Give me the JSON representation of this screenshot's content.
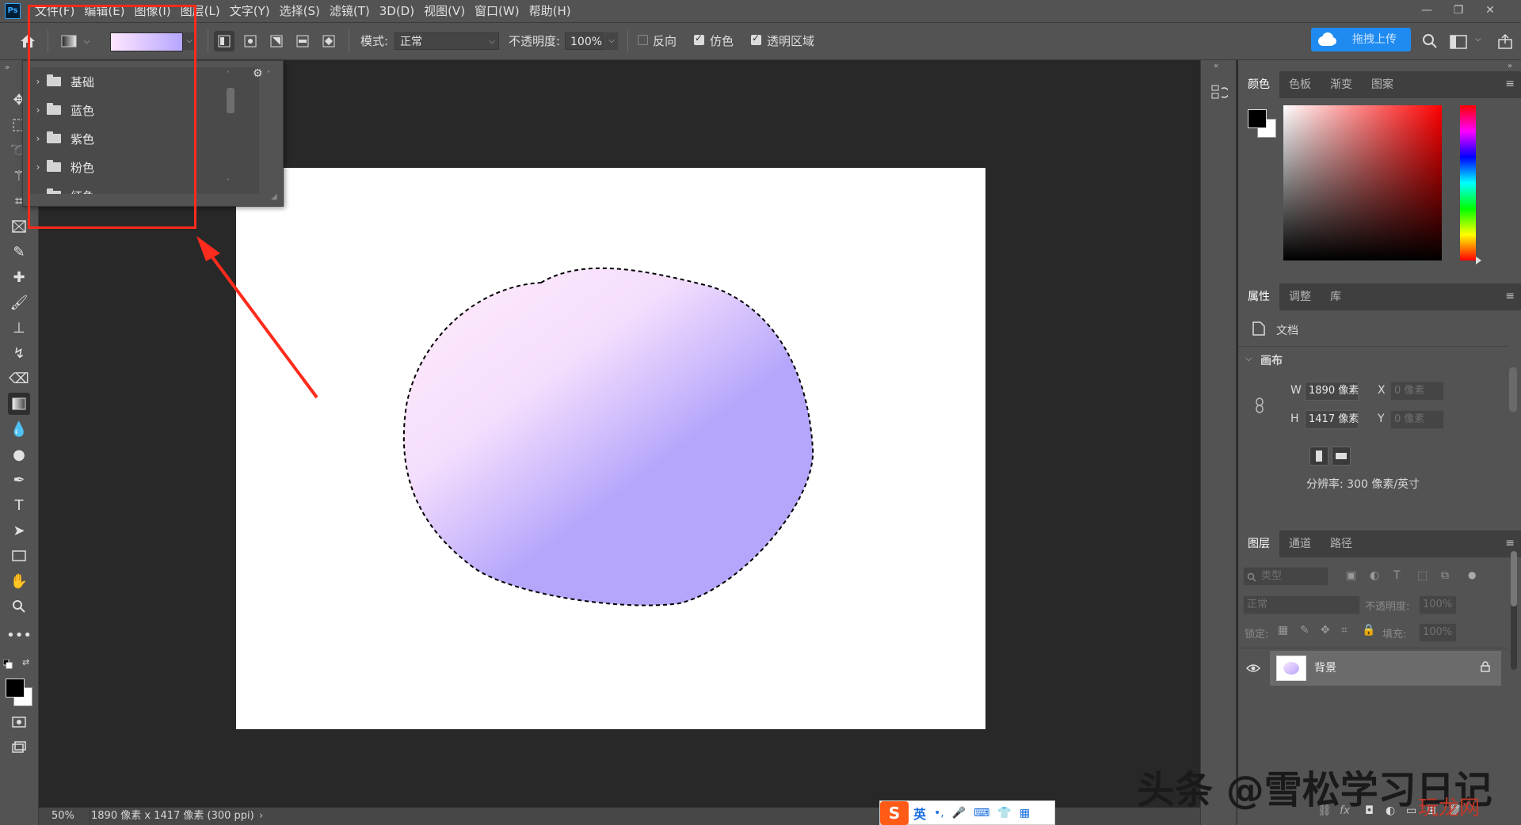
{
  "menu": {
    "logo": "Ps",
    "items": [
      "文件(F)",
      "编辑(E)",
      "图像(I)",
      "图层(L)",
      "文字(Y)",
      "选择(S)",
      "滤镜(T)",
      "3D(D)",
      "视图(V)",
      "窗口(W)",
      "帮助(H)"
    ]
  },
  "options": {
    "mode_label": "模式:",
    "mode_value": "正常",
    "opacity_label": "不透明度:",
    "opacity_value": "100%",
    "reverse_label": "反向",
    "reverse_checked": false,
    "dither_label": "仿色",
    "dither_checked": true,
    "transparency_label": "透明区域",
    "transparency_checked": true,
    "upload_label": "拖拽上传",
    "gradient_start": "#ffe6ff",
    "gradient_end": "#b6a6ff"
  },
  "preset_popup": {
    "folders": [
      "基础",
      "蓝色",
      "紫色",
      "粉色",
      "红色"
    ]
  },
  "color_panel": {
    "tabs": [
      "颜色",
      "色板",
      "渐变",
      "图案"
    ],
    "active_tab": "颜色"
  },
  "properties_panel": {
    "tabs": [
      "属性",
      "调整",
      "库"
    ],
    "doc_label": "文档",
    "section_label": "画布",
    "w_label": "W",
    "w_value": "1890 像素",
    "h_label": "H",
    "h_value": "1417 像素",
    "x_label": "X",
    "x_value": "0 像素",
    "y_label": "Y",
    "y_value": "0 像素",
    "resolution": "分辨率: 300 像素/英寸"
  },
  "layers_panel": {
    "tabs": [
      "图层",
      "通道",
      "路径"
    ],
    "search_placeholder": "类型",
    "blend_mode": "正常",
    "opacity_label": "不透明度:",
    "opacity_value": "100%",
    "lock_label": "锁定:",
    "fill_label": "填充:",
    "fill_value": "100%",
    "layers": [
      {
        "name": "背景",
        "locked": true,
        "visible": true
      }
    ]
  },
  "status": {
    "zoom": "50%",
    "doc_info": "1890 像素 x 1417 像素 (300 ppi)"
  },
  "ime": {
    "lang": "英"
  },
  "watermark": {
    "text": "头条 @雪松学习日记",
    "sub": "玩龙网"
  },
  "colors": {
    "blob_light": "#fbe6fc",
    "blob_dark": "#b6a6fb",
    "highlight": "#ff2b1c",
    "upload_button": "#1f8bf0"
  }
}
